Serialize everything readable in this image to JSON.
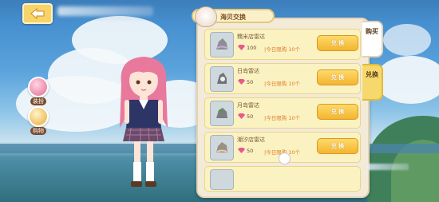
{
  "nav": {
    "back_icon": "back-arrow-icon"
  },
  "side": {
    "buttons": [
      {
        "label": "装扮",
        "icon": "flower-icon"
      },
      {
        "label": "购物",
        "icon": "bag-icon"
      }
    ]
  },
  "shop": {
    "title": "海贝交换",
    "tabs": [
      {
        "label": "购买"
      },
      {
        "label": "兑换"
      }
    ],
    "items": [
      {
        "name": "糯米店雷达",
        "price": "100",
        "limit": "|今日限购 10个",
        "action": "兑 换"
      },
      {
        "name": "日岛雷达",
        "price": "50",
        "limit": "|今日限购 10个",
        "action": "兑 换"
      },
      {
        "name": "月岛雷达",
        "price": "50",
        "limit": "|今日限购 10个",
        "action": "兑 换"
      },
      {
        "name": "潮汐店雷达",
        "price": "50",
        "limit": "|今日限购 10个",
        "action": "兑 换"
      }
    ]
  },
  "colors": {
    "accent": "#f6d86c",
    "panel": "#f3ead7",
    "item_bg": "#fbf2c2",
    "limit_text": "#e07a2a",
    "gem": "#e8598a"
  }
}
